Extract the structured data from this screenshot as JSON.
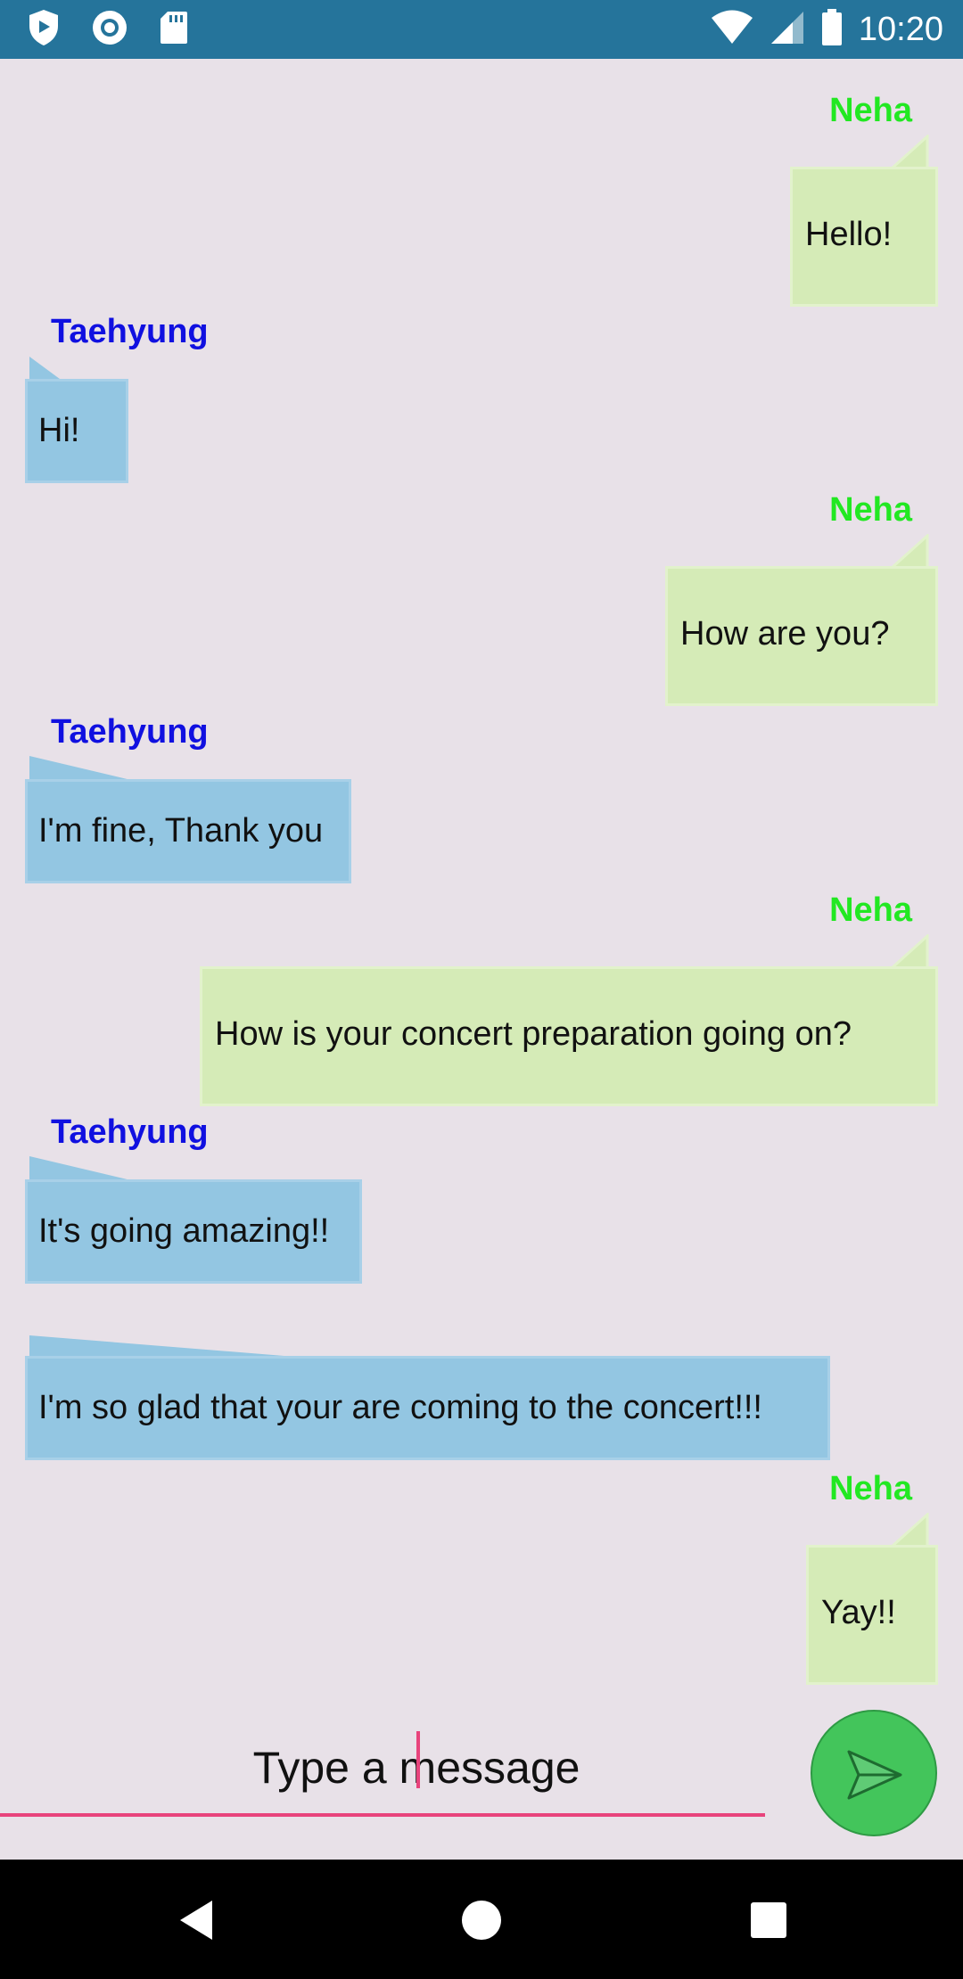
{
  "status_bar": {
    "time": "10:20",
    "left_icons": [
      "shield-icon",
      "record-icon",
      "sd-card-icon"
    ],
    "right_icons": [
      "wifi-icon",
      "signal-icon",
      "battery-icon"
    ],
    "color": "#25749B"
  },
  "messages": [
    {
      "sender": "Neha",
      "text": "Hello!",
      "side": "right"
    },
    {
      "sender": "Taehyung",
      "text": "Hi!",
      "side": "left"
    },
    {
      "sender": "Neha",
      "text": "How are you?",
      "side": "right"
    },
    {
      "sender": "Taehyung",
      "text": "I'm fine, Thank you",
      "side": "left"
    },
    {
      "sender": "Neha",
      "text": "How is your concert preparation going on?",
      "side": "right"
    },
    {
      "sender": "Taehyung",
      "text": "It's going amazing!!",
      "side": "left"
    },
    {
      "sender": "",
      "text": "I'm so glad that your are coming to the concert!!!",
      "side": "left"
    },
    {
      "sender": "Neha",
      "text": "Yay!!",
      "side": "right"
    }
  ],
  "composer": {
    "placeholder": "Type a message",
    "send_icon": "send-icon"
  },
  "nav": {
    "icons": [
      "back-icon",
      "home-icon",
      "recents-icon"
    ]
  },
  "colors": {
    "neha_name": "#22E822",
    "taehyung_name": "#1010E0",
    "green_bubble": "#D5EBB7",
    "blue_bubble": "#93C6E2",
    "accent": "#E8437C",
    "send_button": "#43C55B"
  }
}
